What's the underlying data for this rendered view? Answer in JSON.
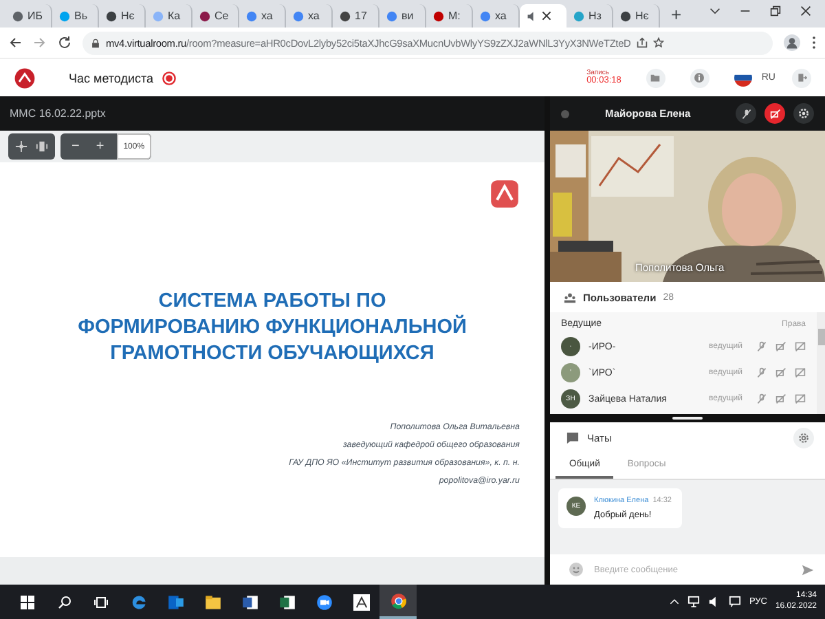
{
  "browser": {
    "tabs": [
      {
        "label": "ИБ",
        "selected": false,
        "color": "#5f6368"
      },
      {
        "label": "Вь",
        "selected": false,
        "color": "#00a4ef"
      },
      {
        "label": "Нє",
        "selected": false,
        "color": "#3c4043"
      },
      {
        "label": "Ка",
        "selected": false,
        "color": "#8ab4f8"
      },
      {
        "label": "Се",
        "selected": false,
        "color": "#8b1a4a"
      },
      {
        "label": "ха",
        "selected": false,
        "color": "#4285f4"
      },
      {
        "label": "ха",
        "selected": false,
        "color": "#4285f4"
      },
      {
        "label": "17",
        "selected": false,
        "color": "#444444"
      },
      {
        "label": "ви",
        "selected": false,
        "color": "#4285f4"
      },
      {
        "label": "М:",
        "selected": false,
        "color": "#c00000"
      },
      {
        "label": "ха",
        "selected": false,
        "color": "#4285f4"
      },
      {
        "selected": true,
        "color": "#5f6368"
      },
      {
        "label": "Нз",
        "selected": false,
        "color": "#25a4c8"
      },
      {
        "label": "Нє",
        "selected": false,
        "color": "#3c4043"
      }
    ],
    "new_tab": "+",
    "address": {
      "host": "mv4.virtualroom.ru",
      "path": "/room?measure=aHR0cDovL2lyby52ci5taXJhcG9saXMucnUvbWlyYS9zZXJ2aWNlL3YyX3NWeTZteD"
    }
  },
  "header": {
    "title": "Час методиста",
    "record_label": "Запись",
    "record_time": "00:03:18",
    "language": "RU"
  },
  "presentation": {
    "file": "ММС 16.02.22.pptx",
    "zoom_out": "−",
    "zoom_in": "+",
    "zoom": "100%",
    "slide": {
      "title": "СИСТЕМА РАБОТЫ ПО ФОРМИРОВАНИЮ ФУНКЦИОНАЛЬНОЙ ГРАМОТНОСТИ ОБУЧАЮЩИХСЯ",
      "lines": [
        "Пополитова Ольга Витальевна",
        "заведующий кафедрой общего образования",
        "ГАУ ДПО ЯО «Институт развития образования», к. п. н.",
        "popolitova@iro.yar.ru"
      ]
    }
  },
  "video": {
    "host": "Майорова Елена",
    "speaker": "Пополитова Ольга",
    "kind": "picture"
  },
  "users": {
    "title": "Пользователи",
    "count": "28",
    "group": "Ведущие",
    "rights": "Права",
    "items": [
      {
        "name": "-ИРО-",
        "role": "ведущий",
        "initials": "·",
        "color": "#4a5640"
      },
      {
        "name": "`ИРО`",
        "role": "ведущий",
        "initials": "'",
        "color": "#8c9a7c"
      },
      {
        "name": "Зайцева Наталия",
        "role": "ведущий",
        "initials": "ЗН",
        "color": "#4d5a44"
      }
    ]
  },
  "chats": {
    "title": "Чаты",
    "tabs": [
      {
        "label": "Общий",
        "selected": true
      },
      {
        "label": "Вопросы",
        "selected": false
      }
    ],
    "messages": [
      {
        "initials": "КЕ",
        "author": "Клюкина Елена",
        "time": "14:32",
        "text": "Добрый день!"
      }
    ],
    "input": {
      "placeholder": "Введите сообщение"
    }
  },
  "taskbar": {
    "apps": [
      {
        "kind": "edge",
        "active": false
      },
      {
        "kind": "outlook",
        "active": false
      },
      {
        "kind": "explorer",
        "active": false
      },
      {
        "kind": "word",
        "active": false
      },
      {
        "kind": "excel",
        "active": false
      },
      {
        "kind": "zoom",
        "active": false
      },
      {
        "kind": "app",
        "active": false
      },
      {
        "kind": "chrome",
        "active": true
      }
    ],
    "language": "РУС",
    "time": "14:34",
    "date": "16.02.2022"
  }
}
